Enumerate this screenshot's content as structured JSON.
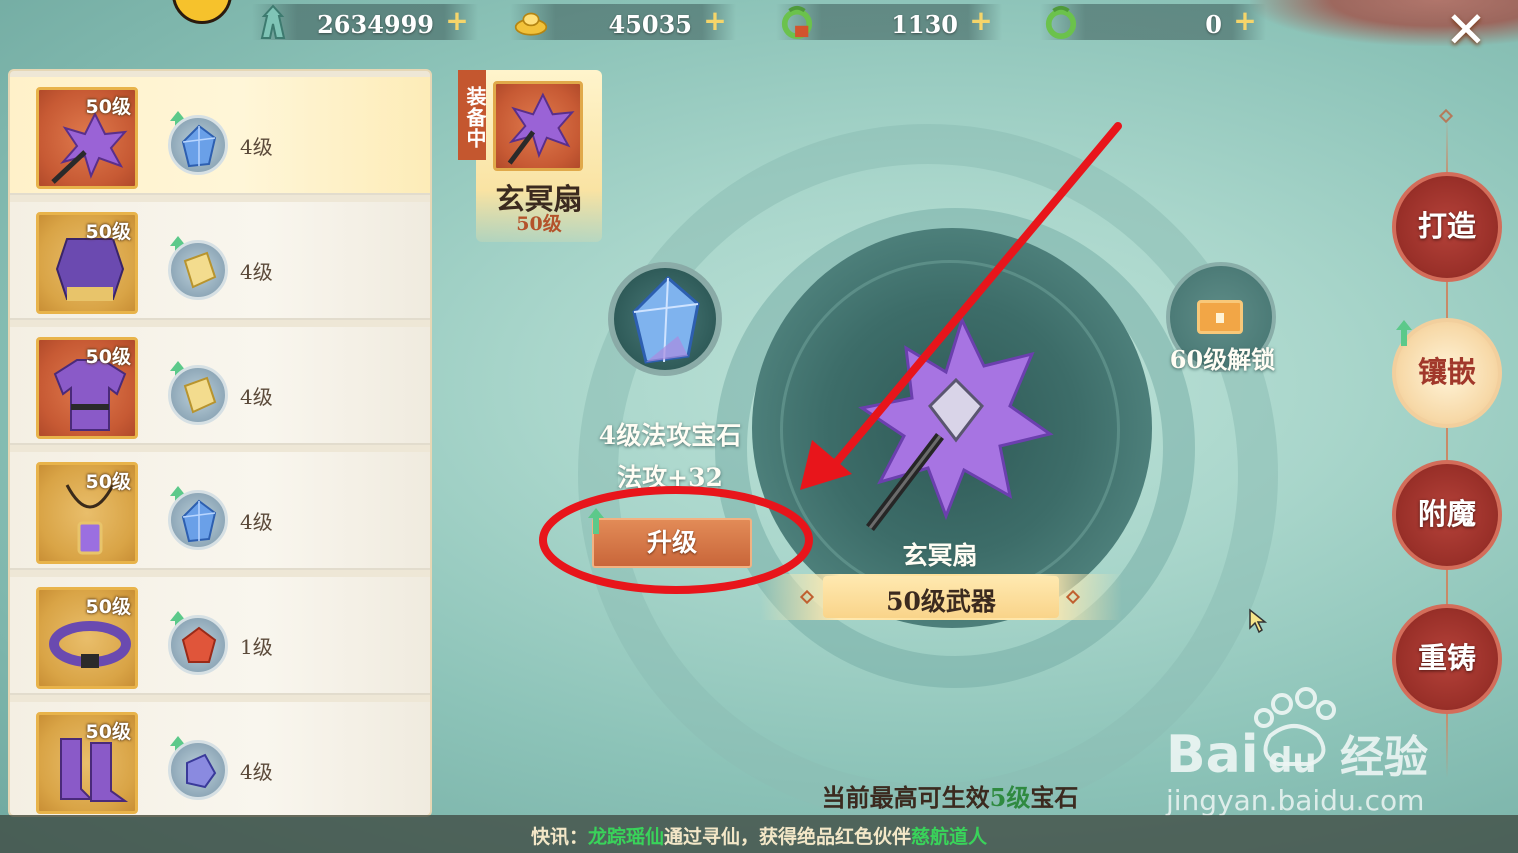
{
  "currencies": [
    {
      "id": "tower",
      "value": "2634999",
      "plus": "+"
    },
    {
      "id": "gold-ingot",
      "value": "45035",
      "plus": "+"
    },
    {
      "id": "bound-jade",
      "value": "1130",
      "plus": "+"
    },
    {
      "id": "jade",
      "value": "0",
      "plus": "+"
    }
  ],
  "close_label": "✕",
  "equipment_list": [
    {
      "level": "50级",
      "gem_level": "4级",
      "gem": "blue-crystal",
      "slot": "weapon",
      "selected": true
    },
    {
      "level": "50级",
      "gem_level": "4级",
      "gem": "yellow-stone",
      "slot": "shoulder"
    },
    {
      "level": "50级",
      "gem_level": "4级",
      "gem": "yellow-stone",
      "slot": "robe"
    },
    {
      "level": "50级",
      "gem_level": "4级",
      "gem": "blue-crystal",
      "slot": "necklace"
    },
    {
      "level": "50级",
      "gem_level": "1级",
      "gem": "red-ruby",
      "slot": "belt"
    },
    {
      "level": "50级",
      "gem_level": "4级",
      "gem": "blue-oval",
      "slot": "boots"
    }
  ],
  "equipped": {
    "tag": "装备中",
    "name": "玄冥扇",
    "level": "50级"
  },
  "gem_slot": {
    "name": "4级法攻宝石",
    "stat": "法攻+32",
    "upgrade_label": "升级"
  },
  "locked_slot": {
    "text": "60级解锁"
  },
  "weapon": {
    "name": "玄冥扇",
    "banner": "50级武器"
  },
  "max_gem": {
    "prefix": "当前最高可生效",
    "highlight": "5级",
    "suffix": "宝石"
  },
  "side_menu": [
    {
      "label": "打造",
      "active": false
    },
    {
      "label": "镶嵌",
      "active": true
    },
    {
      "label": "附魔",
      "active": false
    },
    {
      "label": "重铸",
      "active": false
    }
  ],
  "ticker": {
    "prefix": "快讯：",
    "player": "龙踪瑶仙",
    "middle": "通过寻仙，获得绝品红色伙伴",
    "partner": "慈航道人"
  },
  "watermark": {
    "brand": "Baidu经验",
    "url": "jingyan.baidu.com"
  },
  "colors": {
    "accent_red": "#c4572f",
    "button_orange": "#d8764a",
    "highlight_green": "#2f8a40",
    "annotation_red": "#e8151b"
  }
}
